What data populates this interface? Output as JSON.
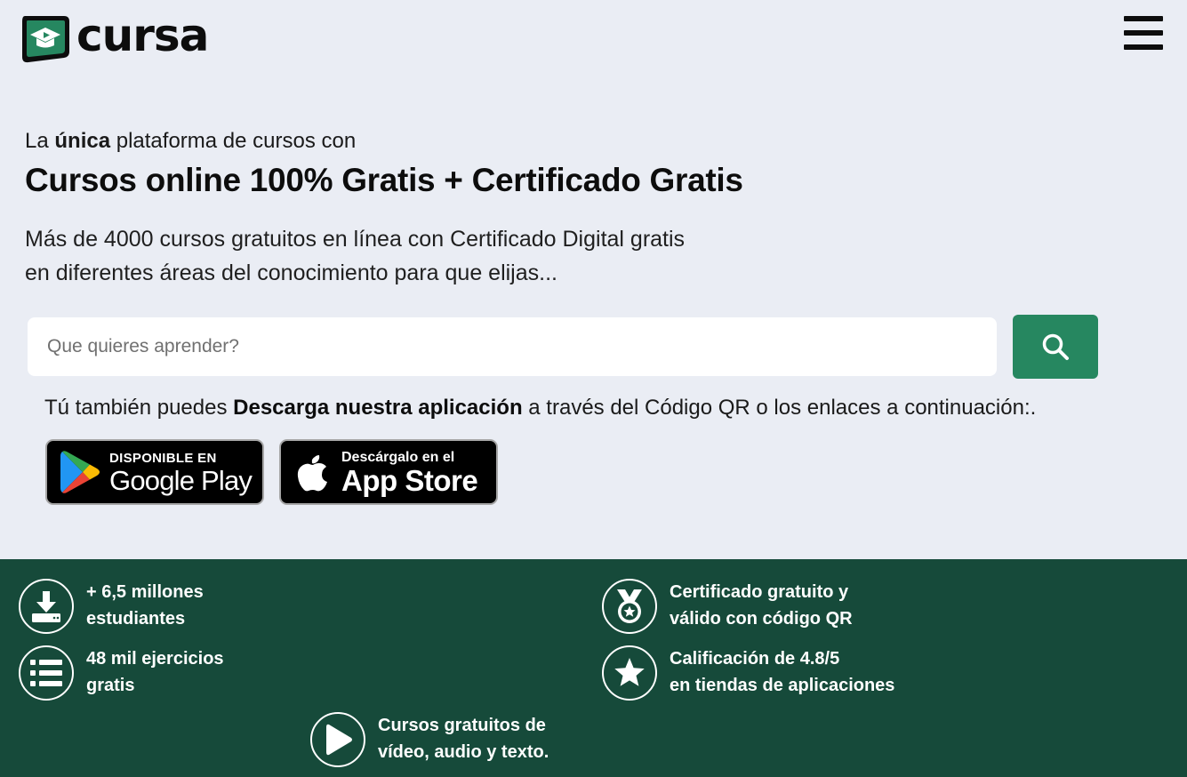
{
  "header": {
    "logo_text": "cursa",
    "menu_icon": "hamburger-menu-icon"
  },
  "hero": {
    "kicker_pre": "La ",
    "kicker_bold": "única",
    "kicker_post": " plataforma de cursos con",
    "headline": "Cursos online 100% Gratis + Certificado Gratis",
    "description_line1": "Más de 4000 cursos gratuitos en línea con Certificado Digital gratis",
    "description_line2": "en diferentes áreas del conocimiento para que elijas..."
  },
  "search": {
    "placeholder": "Que quieres aprender?",
    "value": "",
    "button_icon": "search-icon"
  },
  "download": {
    "pre": "Tú también puedes ",
    "bold": "Descarga nuestra aplicación",
    "post": " a través del Código QR o los enlaces a continuación:."
  },
  "stores": {
    "google_play": {
      "small": "DISPONIBLE EN",
      "big": "Google Play"
    },
    "app_store": {
      "small": "Descárgalo en el",
      "big": "App Store"
    }
  },
  "features": [
    {
      "icon": "download-icon",
      "line1": "+ 6,5 millones",
      "line2": "estudiantes"
    },
    {
      "icon": "medal-icon",
      "line1": "Certificado gratuito y",
      "line2": "válido con código QR"
    },
    {
      "icon": "list-icon",
      "line1": "48 mil ejercicios",
      "line2": "gratis"
    },
    {
      "icon": "star-icon",
      "line1": "Calificación de 4.8/5",
      "line2": "en tiendas de aplicaciones"
    },
    {
      "icon": "play-icon",
      "line1": "Cursos gratuitos de",
      "line2": "vídeo, audio y texto."
    }
  ],
  "colors": {
    "page_bg": "#eaedf4",
    "brand_green": "#268760",
    "band_green": "#164a3a"
  }
}
